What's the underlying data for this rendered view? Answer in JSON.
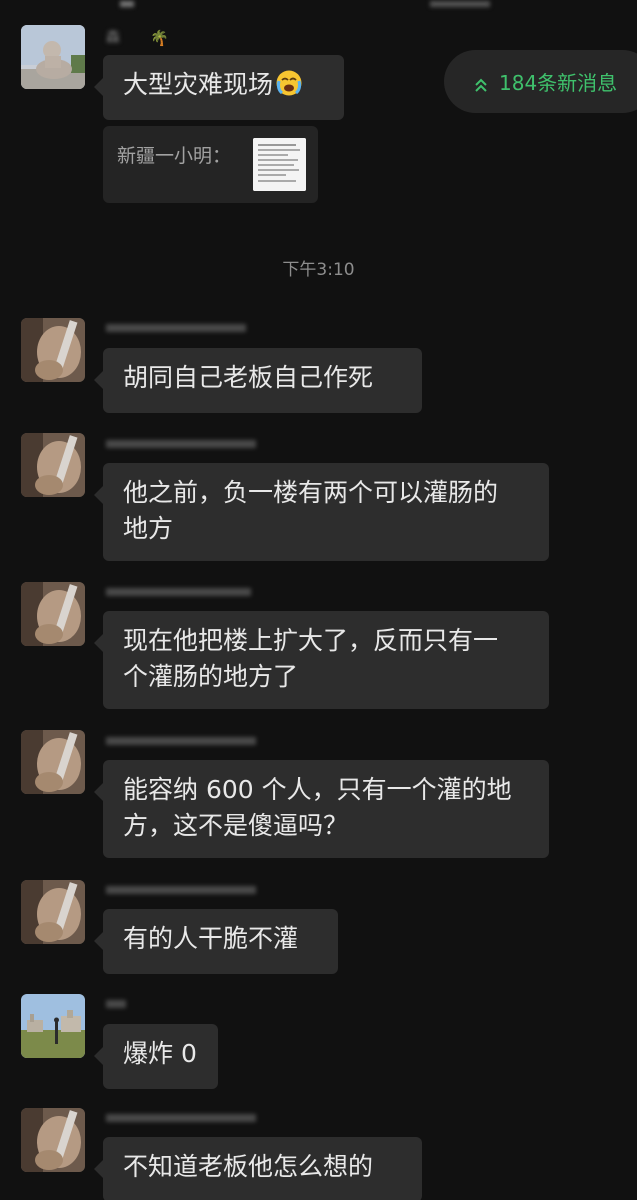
{
  "new_messages_pill": {
    "label": "184条新消息",
    "color": "#3fc16c"
  },
  "time_divider": "下午3:10",
  "messages": [
    {
      "sender": "森",
      "sender_suffix": "🌴",
      "text": "大型灾难现场",
      "emoji": "😭",
      "quote": {
        "label": "新疆一小明："
      }
    },
    {
      "sender": "",
      "text": "胡同自己老板自己作死"
    },
    {
      "sender": "",
      "text_lines": [
        "他之前，负一楼有两个可以灌肠的",
        "地方"
      ]
    },
    {
      "sender": "",
      "text_lines": [
        "现在他把楼上扩大了，反而只有一",
        "个灌肠的地方了"
      ]
    },
    {
      "sender": "",
      "text_lines": [
        "能容纳 600 个人，只有一个灌的地",
        "方，这不是傻逼吗？"
      ]
    },
    {
      "sender": "",
      "text": "有的人干脆不灌"
    },
    {
      "sender": "",
      "text": "爆炸 0"
    },
    {
      "sender": "",
      "text": "不知道老板他怎么想的"
    }
  ],
  "colors": {
    "background": "#111111",
    "bubble": "#2d2d2d",
    "text": "#e8e8e8",
    "accent_green": "#3fc16c"
  },
  "icons": [
    "chevron-double-up-icon",
    "crying-face-emoji",
    "palm-tree-emoji"
  ]
}
